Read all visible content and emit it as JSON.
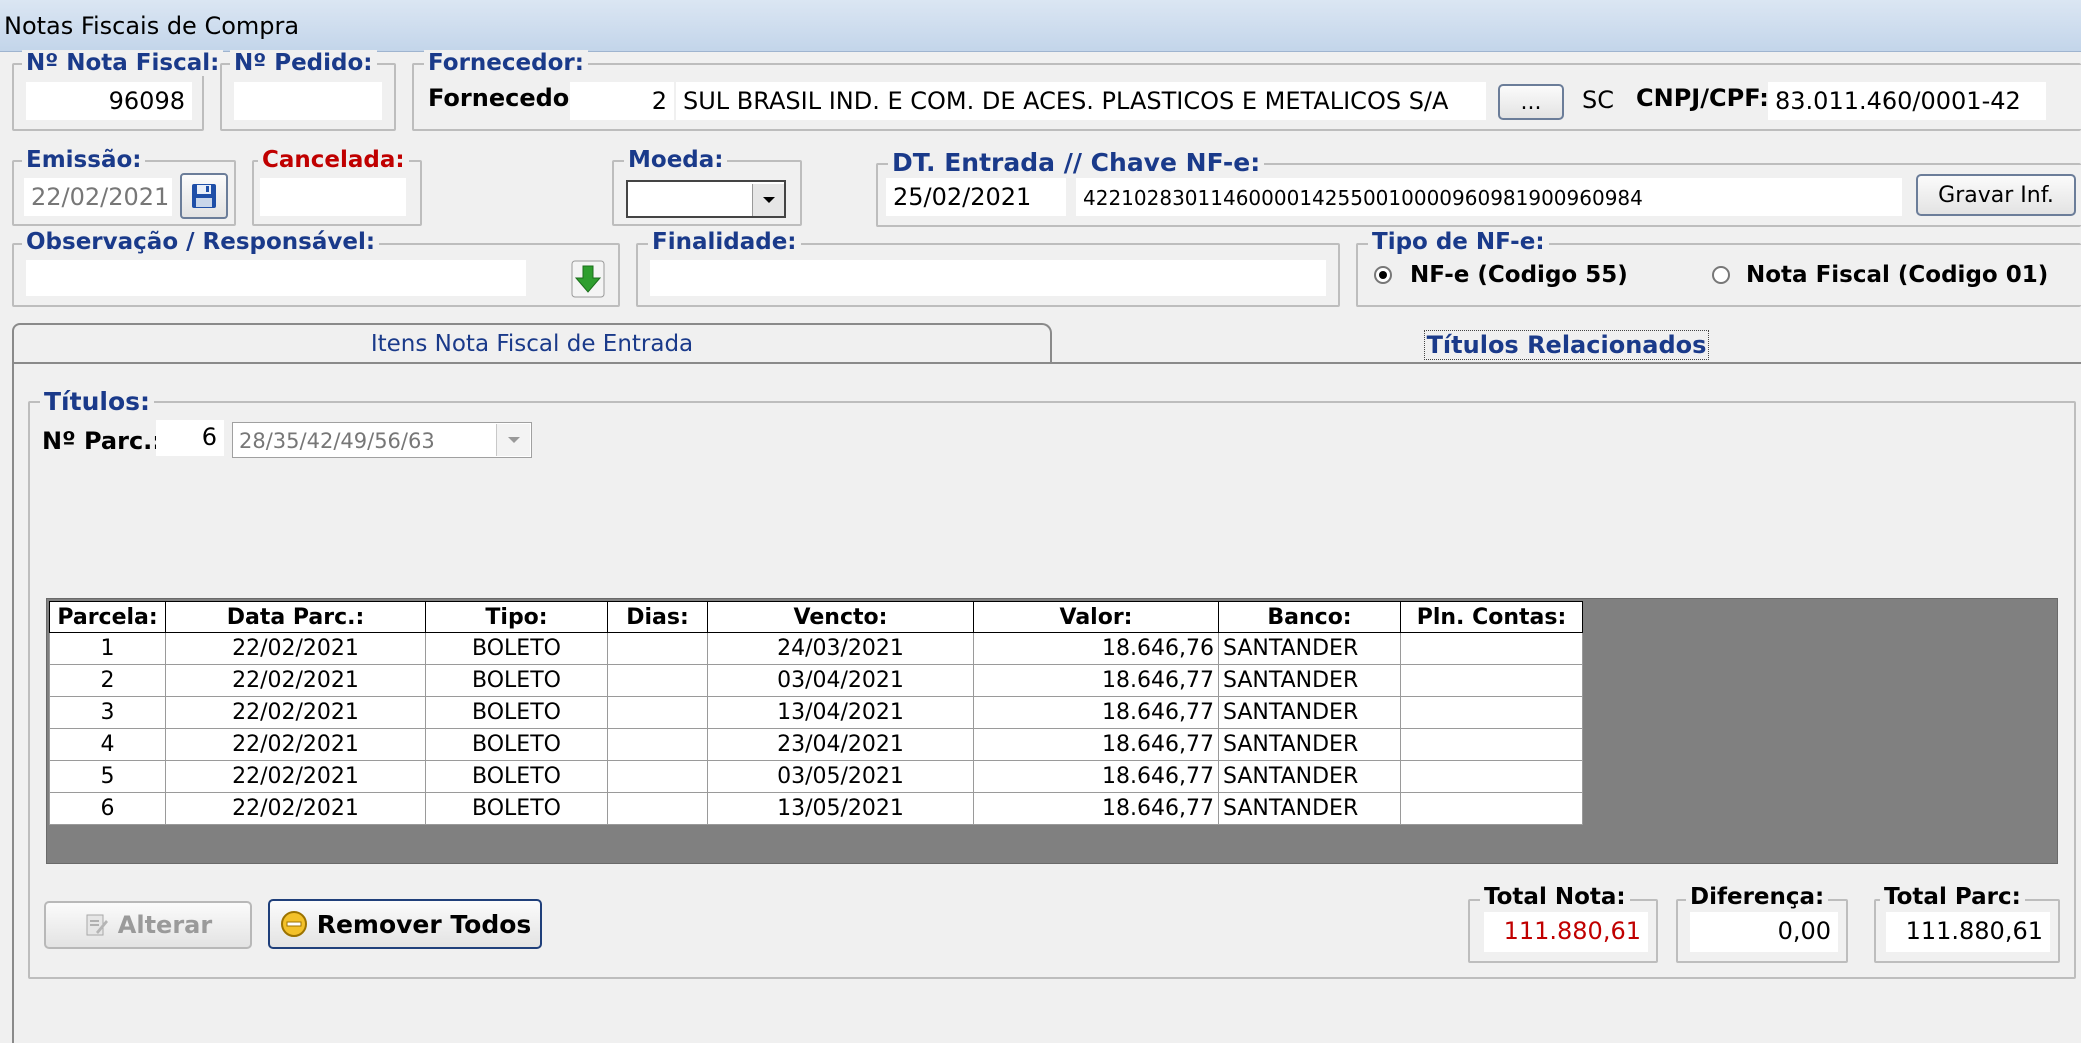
{
  "window": {
    "title": "Notas Fiscais de Compra"
  },
  "header": {
    "nota_fiscal": {
      "label": "Nº Nota Fiscal:",
      "value": "96098"
    },
    "pedido": {
      "label": "Nº Pedido:",
      "value": ""
    },
    "fornecedor": {
      "group_label": "Fornecedor:",
      "label": "Fornecedor:",
      "code": "2",
      "name": "SUL BRASIL IND. E COM. DE ACES. PLASTICOS E METALICOS S/A",
      "browse_label": "...",
      "uf": "SC",
      "cnpj_label": "CNPJ/CPF:",
      "cnpj": "83.011.460/0001-42"
    },
    "emissao": {
      "label": "Emissão:",
      "value": "22/02/2021"
    },
    "cancelada": {
      "label": "Cancelada:",
      "value": ""
    },
    "moeda": {
      "label": "Moeda:",
      "value": ""
    },
    "entrada": {
      "label": "DT. Entrada // Chave NF-e:",
      "date": "25/02/2021",
      "chave": "42210283011460000142550010000960981900960984",
      "save_label": "Gravar Inf."
    },
    "observacao": {
      "label": "Observação / Responsável:",
      "value": ""
    },
    "finalidade": {
      "label": "Finalidade:",
      "value": ""
    },
    "tipo_nfe": {
      "label": "Tipo de NF-e:",
      "options": [
        {
          "label": "NF-e (Codigo 55)",
          "selected": true
        },
        {
          "label": "Nota Fiscal (Codigo 01)",
          "selected": false
        }
      ]
    }
  },
  "tabs": [
    {
      "label": "Itens Nota Fiscal de Entrada",
      "active": false
    },
    {
      "label": "Títulos Relacionados",
      "active": true
    }
  ],
  "titulos": {
    "group_label": "Títulos:",
    "parcelas_label": "Nº Parc.:",
    "parcelas_count": "6",
    "parcelas_days": "28/35/42/49/56/63",
    "table": {
      "columns": [
        "Parcela:",
        "Data Parc.:",
        "Tipo:",
        "Dias:",
        "Vencto:",
        "Valor:",
        "Banco:",
        "Pln. Contas:"
      ],
      "rows": [
        [
          "1",
          "22/02/2021",
          "BOLETO",
          "",
          "24/03/2021",
          "18.646,76",
          "SANTANDER",
          ""
        ],
        [
          "2",
          "22/02/2021",
          "BOLETO",
          "",
          "03/04/2021",
          "18.646,77",
          "SANTANDER",
          ""
        ],
        [
          "3",
          "22/02/2021",
          "BOLETO",
          "",
          "13/04/2021",
          "18.646,77",
          "SANTANDER",
          ""
        ],
        [
          "4",
          "22/02/2021",
          "BOLETO",
          "",
          "23/04/2021",
          "18.646,77",
          "SANTANDER",
          ""
        ],
        [
          "5",
          "22/02/2021",
          "BOLETO",
          "",
          "03/05/2021",
          "18.646,77",
          "SANTANDER",
          ""
        ],
        [
          "6",
          "22/02/2021",
          "BOLETO",
          "",
          "13/05/2021",
          "18.646,77",
          "SANTANDER",
          ""
        ]
      ]
    },
    "alterar_label": "Alterar",
    "remover_label": "Remover Todos",
    "total_nota": {
      "label": "Total Nota:",
      "value": "111.880,61"
    },
    "diferenca": {
      "label": "Diferença:",
      "value": "0,00"
    },
    "total_parc": {
      "label": "Total Parc:",
      "value": "111.880,61"
    }
  },
  "colors": {
    "label_blue": "#1a3a8a",
    "label_red": "#c00000",
    "total_red": "#c00000",
    "grid_bg": "#808080"
  }
}
